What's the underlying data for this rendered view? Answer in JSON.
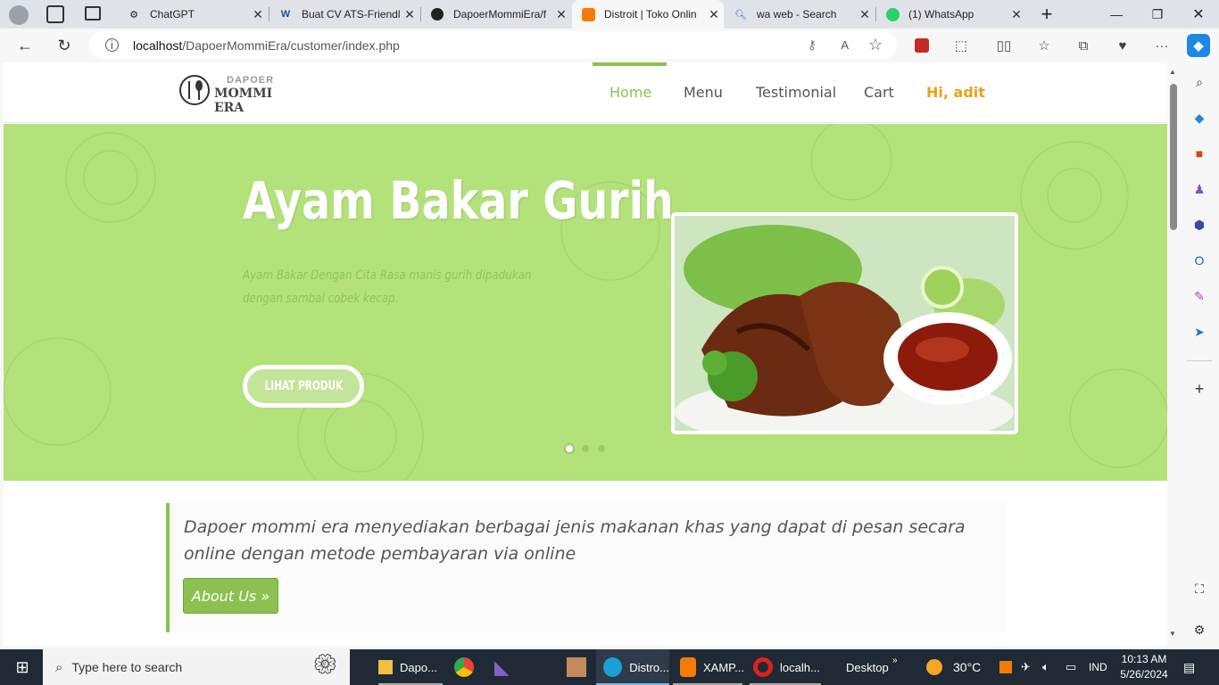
{
  "browser": {
    "tabs": [
      {
        "title": "ChatGPT"
      },
      {
        "title": "Buat CV ATS-Friendl"
      },
      {
        "title": "DapoerMommiEra/f"
      },
      {
        "title": "Distroit | Toko Onlin"
      },
      {
        "title": "wa web - Search"
      },
      {
        "title": "(1) WhatsApp"
      }
    ],
    "url_host": "localhost",
    "url_path": "/DapoerMommiEra/customer/index.php"
  },
  "site": {
    "logo_top": "DAPOER",
    "logo_bottom": "MOMMI ERA",
    "nav": {
      "home": "Home",
      "menu": "Menu",
      "testimonial": "Testimonial",
      "cart": "Cart",
      "user": "Hi, adit"
    },
    "hero": {
      "title": "Ayam Bakar Gurih",
      "desc": "Ayam Bakar Dengan Cita Rasa manis gurih dipadukan dengan sambal cobek kecap.",
      "button": "LIHAT PRODUK",
      "slides": 3,
      "active_slide": 1
    },
    "about": {
      "text": "Dapoer mommi era menyediakan berbagai jenis makanan khas yang dapat di pesan secara online dengan metode pembayaran via online",
      "button": "About Us »"
    }
  },
  "taskbar": {
    "search_placeholder": "Type here to search",
    "apps": [
      "Dapo...",
      "Distro...",
      "XAMP...",
      "localh..."
    ],
    "desktop": "Desktop",
    "temperature": "30°C",
    "lang": "IND",
    "time": "10:13 AM",
    "date": "5/26/2024"
  },
  "colors": {
    "accent": "#8cc152",
    "user": "#e8a317",
    "hero_bg": "#b3e27a"
  }
}
